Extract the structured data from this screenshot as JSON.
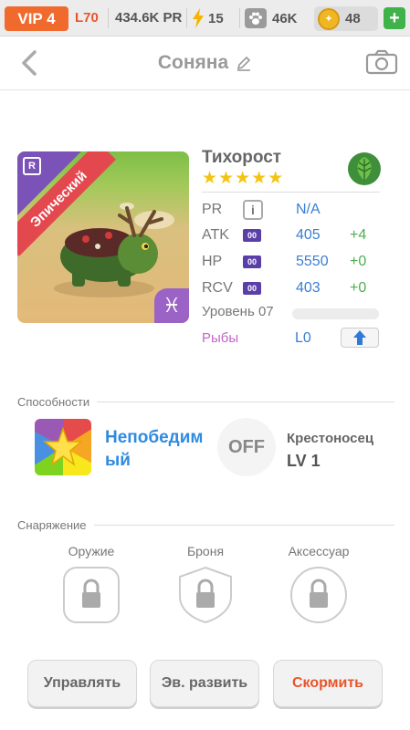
{
  "topbar": {
    "vip": "VIP 4",
    "level": "L70",
    "pr": "434.6K PR",
    "energy": "15",
    "paw": "46K",
    "coins": "48",
    "plus": "+"
  },
  "header": {
    "title": "Соняна"
  },
  "pet": {
    "name": "Тихорост",
    "stars": "★★★★★",
    "rarity_badge": "R",
    "rarity": "Эпический",
    "zodiac": "♓",
    "stats": [
      {
        "label": "PR",
        "value": "N/A",
        "bonus": ""
      },
      {
        "label": "ATK",
        "badge": "00",
        "value": "405",
        "bonus": "+4"
      },
      {
        "label": "HP",
        "badge": "00",
        "value": "5550",
        "bonus": "+0"
      },
      {
        "label": "RCV",
        "badge": "00",
        "value": "403",
        "bonus": "+0"
      }
    ],
    "info_glyph": "i",
    "level": "Уровень 07",
    "fish_label": "Рыбы",
    "fish_value": "L0"
  },
  "abilities": {
    "title": "Способности",
    "skill_name": "Непобедим\nый",
    "skill_name_line1": "Непобедим",
    "skill_name_line2": "ый",
    "off_label": "OFF",
    "ability2_name": "Крестоносец",
    "ability2_level": "LV 1"
  },
  "equipment": {
    "title": "Снаряжение",
    "slots": [
      "Оружие",
      "Броня",
      "Аксессуар"
    ]
  },
  "buttons": {
    "manage": "Управлять",
    "evolve": "Эв. развить",
    "feed": "Скормить",
    "feed_color": "#e8552a"
  }
}
